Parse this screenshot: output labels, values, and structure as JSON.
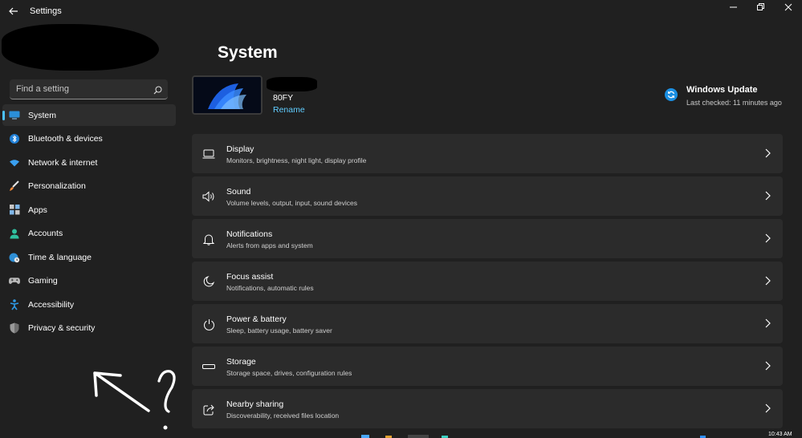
{
  "app": {
    "title": "Settings"
  },
  "search": {
    "placeholder": "Find a setting"
  },
  "sidebar": {
    "items": [
      {
        "label": "System",
        "icon": "monitor-icon",
        "active": true
      },
      {
        "label": "Bluetooth & devices",
        "icon": "bluetooth-icon"
      },
      {
        "label": "Network & internet",
        "icon": "wifi-icon"
      },
      {
        "label": "Personalization",
        "icon": "brush-icon"
      },
      {
        "label": "Apps",
        "icon": "apps-icon"
      },
      {
        "label": "Accounts",
        "icon": "person-icon"
      },
      {
        "label": "Time & language",
        "icon": "globe-clock-icon"
      },
      {
        "label": "Gaming",
        "icon": "gamepad-icon"
      },
      {
        "label": "Accessibility",
        "icon": "accessibility-icon"
      },
      {
        "label": "Privacy & security",
        "icon": "shield-icon"
      }
    ]
  },
  "main": {
    "title": "System",
    "device": {
      "name": "80FY",
      "rename_label": "Rename"
    },
    "update": {
      "title": "Windows Update",
      "status": "Last checked: 11 minutes ago"
    },
    "cards": [
      {
        "title": "Display",
        "subtitle": "Monitors, brightness, night light, display profile",
        "icon": "laptop-icon"
      },
      {
        "title": "Sound",
        "subtitle": "Volume levels, output, input, sound devices",
        "icon": "speaker-icon"
      },
      {
        "title": "Notifications",
        "subtitle": "Alerts from apps and system",
        "icon": "bell-icon"
      },
      {
        "title": "Focus assist",
        "subtitle": "Notifications, automatic rules",
        "icon": "moon-icon"
      },
      {
        "title": "Power & battery",
        "subtitle": "Sleep, battery usage, battery saver",
        "icon": "power-icon"
      },
      {
        "title": "Storage",
        "subtitle": "Storage space, drives, configuration rules",
        "icon": "storage-icon"
      },
      {
        "title": "Nearby sharing",
        "subtitle": "Discoverability, received files location",
        "icon": "share-icon"
      }
    ]
  },
  "taskbar": {
    "clock": "10:43 AM"
  },
  "colors": {
    "accent": "#4cc2ff",
    "link": "#60cdff",
    "background": "#202020",
    "card": "#2b2b2b"
  }
}
